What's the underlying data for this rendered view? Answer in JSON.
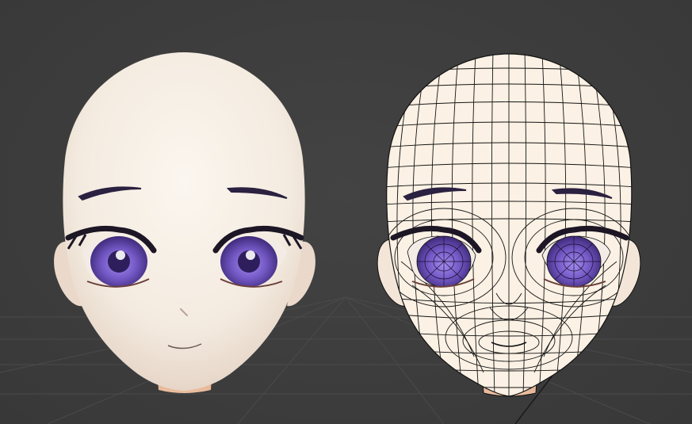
{
  "scene": {
    "background_color": "#3d3d3d",
    "grid_color": "#4a4a4a",
    "skin_color": "#f5ece2",
    "skin_shadow_color": "#e6d3c4",
    "neck_color": "#e5b596",
    "iris_color": "#7357c4",
    "iris_dark_color": "#3d2a78",
    "brow_color": "#2b2140",
    "wire_color": "#111111"
  },
  "models": [
    {
      "view": "shaded"
    },
    {
      "view": "wireframe"
    }
  ]
}
